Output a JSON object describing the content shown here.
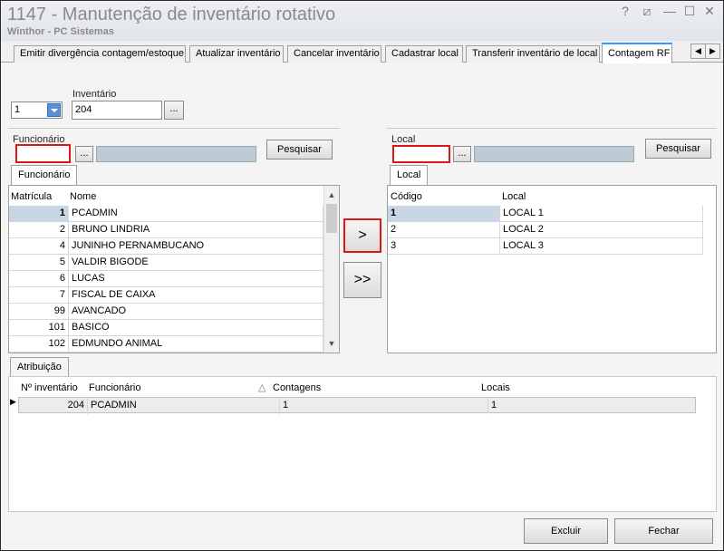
{
  "window": {
    "title": "1147 - Manutenção de inventário rotativo",
    "subtitle": "Winthor - PC Sistemas",
    "controls": [
      "?",
      "⧄",
      "—",
      "☐",
      "✕"
    ]
  },
  "tabs": [
    {
      "label": "Emitir divergência contagem/estoque",
      "active": false
    },
    {
      "label": "Atualizar inventário",
      "active": false
    },
    {
      "label": "Cancelar inventário",
      "active": false
    },
    {
      "label": "Cadastrar local",
      "active": false
    },
    {
      "label": "Transferir inventário de local",
      "active": false
    },
    {
      "label": "Contagem RF",
      "active": true
    }
  ],
  "top": {
    "combo_value": "1",
    "inventario_label": "Inventário",
    "inventario_value": "204",
    "ellipsis": "..."
  },
  "left": {
    "funcionario_label": "Funcionário",
    "search_label": "Pesquisar",
    "tab_label": "Funcionário",
    "columns": [
      "Matrícula",
      "Nome"
    ],
    "rows": [
      {
        "matricula": "1",
        "nome": "PCADMIN"
      },
      {
        "matricula": "2",
        "nome": "BRUNO LINDRIA"
      },
      {
        "matricula": "4",
        "nome": "JUNINHO PERNAMBUCANO"
      },
      {
        "matricula": "5",
        "nome": "VALDIR BIGODE"
      },
      {
        "matricula": "6",
        "nome": "LUCAS"
      },
      {
        "matricula": "7",
        "nome": "FISCAL DE CAIXA"
      },
      {
        "matricula": "99",
        "nome": "AVANCADO"
      },
      {
        "matricula": "101",
        "nome": "BASICO"
      },
      {
        "matricula": "102",
        "nome": "EDMUNDO ANIMAL"
      }
    ]
  },
  "middle": {
    "add_one": ">",
    "add_all": ">>"
  },
  "right": {
    "local_label": "Local",
    "search_label": "Pesquisar",
    "tab_label": "Local",
    "columns": [
      "Código",
      "Local"
    ],
    "rows": [
      {
        "codigo": "1",
        "local": "LOCAL 1"
      },
      {
        "codigo": "2",
        "local": "LOCAL 2"
      },
      {
        "codigo": "3",
        "local": "LOCAL 3"
      }
    ]
  },
  "atribuicao": {
    "tab_label": "Atribuição",
    "columns": [
      "Nº inventário",
      "Funcionário",
      "Contagens",
      "Locais"
    ],
    "rows": [
      {
        "inventario": "204",
        "funcionario": "PCADMIN",
        "contagens": "1",
        "locais": "1"
      }
    ]
  },
  "footer": {
    "excluir": "Excluir",
    "fechar": "Fechar"
  },
  "colors": {
    "highlight_red": "#e01515",
    "active_tab": "#3399ff",
    "selected_row": "#c9d6e5"
  }
}
